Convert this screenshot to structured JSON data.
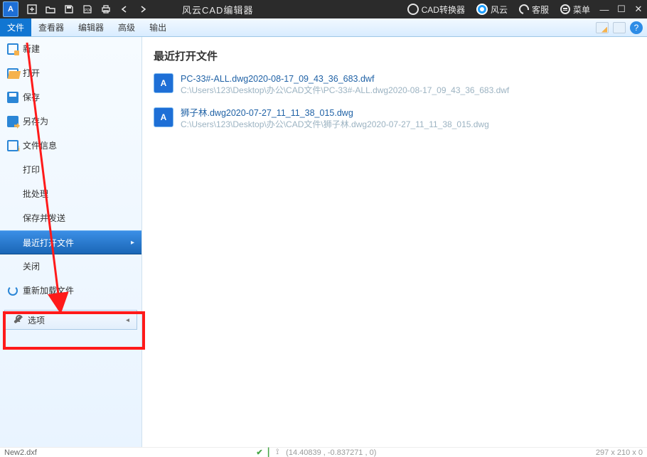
{
  "app_icon_letter": "A",
  "app_title": "风云CAD编辑器",
  "top_links": {
    "converter": "CAD转换器",
    "fengyun": "风云",
    "kefu": "客服",
    "menu": "菜单"
  },
  "menubar": {
    "file": "文件",
    "viewer": "查看器",
    "editor": "编辑器",
    "advanced": "高级",
    "output": "输出"
  },
  "sidebar": {
    "new": "新建",
    "open": "打开",
    "save": "保存",
    "save_as": "另存为",
    "file_info": "文件信息",
    "print": "打印",
    "batch": "批处理",
    "save_send": "保存并发送",
    "recent": "最近打开文件",
    "close": "关闭",
    "reload": "重新加载文件",
    "options": "选项"
  },
  "content": {
    "title": "最近打开文件",
    "files": [
      {
        "name": "PC-33#-ALL.dwg2020-08-17_09_43_36_683.dwf",
        "path": "C:\\Users\\123\\Desktop\\办公\\CAD文件\\PC-33#-ALL.dwg2020-08-17_09_43_36_683.dwf"
      },
      {
        "name": "狮子林.dwg2020-07-27_11_11_38_015.dwg",
        "path": "C:\\Users\\123\\Desktop\\办公\\CAD文件\\狮子林.dwg2020-07-27_11_11_38_015.dwg"
      }
    ]
  },
  "bottom": {
    "tab": "New2.dxf",
    "coords": "(14.40839 , -0.837271 , 0)",
    "dims": "297 x 210 x 0"
  },
  "help_glyph": "?"
}
